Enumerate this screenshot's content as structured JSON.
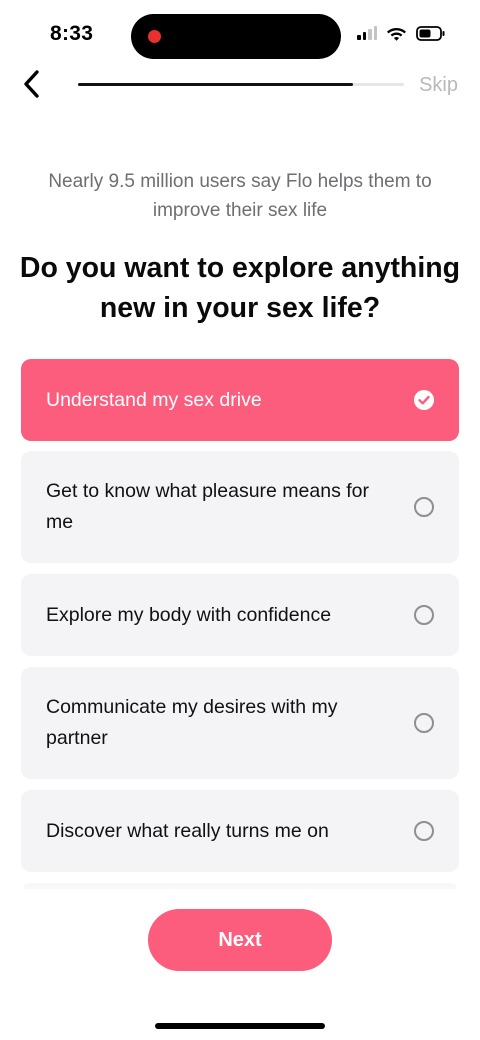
{
  "status_bar": {
    "time": "8:33",
    "icons": [
      "cellular-signal-icon",
      "wifi-icon",
      "battery-icon"
    ]
  },
  "nav": {
    "back_icon": "chevron-left-icon",
    "progress": 0.845,
    "skip_label": "Skip"
  },
  "header": {
    "subtitle": "Nearly 9.5 million users say Flo helps them to improve their sex life",
    "title": "Do you want to explore anything new in your sex life?"
  },
  "options": [
    {
      "label": "Understand my sex drive",
      "selected": true
    },
    {
      "label": "Get to know what pleasure means for me",
      "selected": false
    },
    {
      "label": "Explore my body with confidence",
      "selected": false
    },
    {
      "label": "Communicate my desires with my partner",
      "selected": false
    },
    {
      "label": "Discover what really turns me on",
      "selected": false
    }
  ],
  "footer": {
    "next_label": "Next"
  },
  "colors": {
    "accent": "#fd5d7c",
    "option_background": "#f4f4f6",
    "subtitle_text": "#6e6e73",
    "skip_text": "#b9b9bd"
  }
}
